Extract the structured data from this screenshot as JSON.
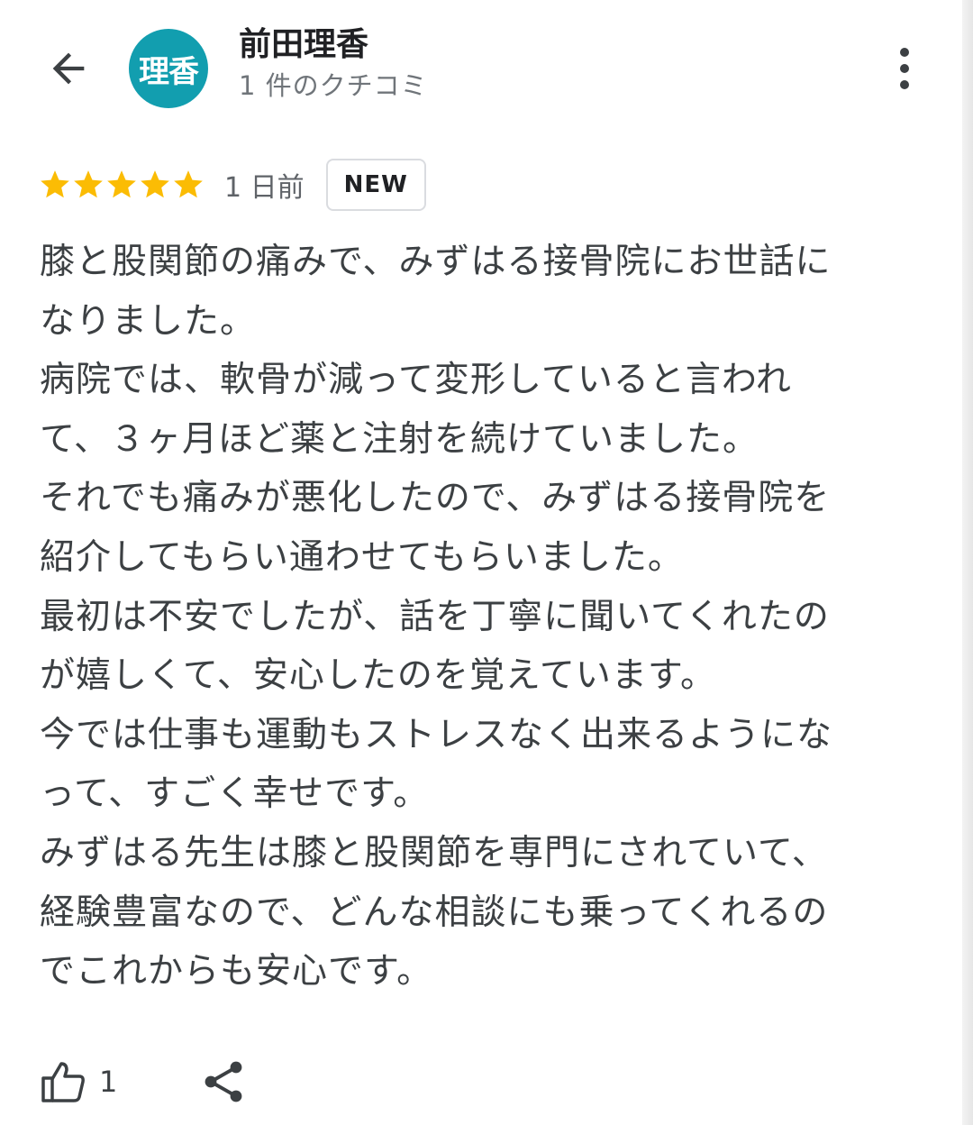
{
  "colors": {
    "avatar_bg": "#129eaf",
    "star": "#fbbc04",
    "text_primary": "#202124",
    "text_secondary": "#70757a",
    "icon": "#5f6368"
  },
  "header": {
    "back_icon": "arrow-left-icon",
    "avatar_text": "理香",
    "reviewer_name": "前田理香",
    "review_count": "1 件のクチコミ",
    "more_icon": "more-vert-icon"
  },
  "review": {
    "rating": 5,
    "rating_max": 5,
    "date": "1 日前",
    "badge": "NEW",
    "lines": [
      "膝と股関節の痛みで、みずはる接骨院にお世話に",
      "なりました。",
      "病院では、軟骨が減って変形していると言われ",
      "て、３ヶ月ほど薬と注射を続けていました。",
      "それでも痛みが悪化したので、みずはる接骨院を",
      "紹介してもらい通わせてもらいました。",
      "最初は不安でしたが、話を丁寧に聞いてくれたの",
      "が嬉しくて、安心したのを覚えています。",
      "今では仕事も運動もストレスなく出来るようにな",
      "って、すごく幸せです。",
      "みずはる先生は膝と股関節を専門にされていて、",
      "経験豊富なので、どんな相談にも乗ってくれるの",
      "でこれからも安心です。"
    ]
  },
  "actions": {
    "like_icon": "thumb-up-icon",
    "like_count": "1",
    "share_icon": "share-icon"
  }
}
